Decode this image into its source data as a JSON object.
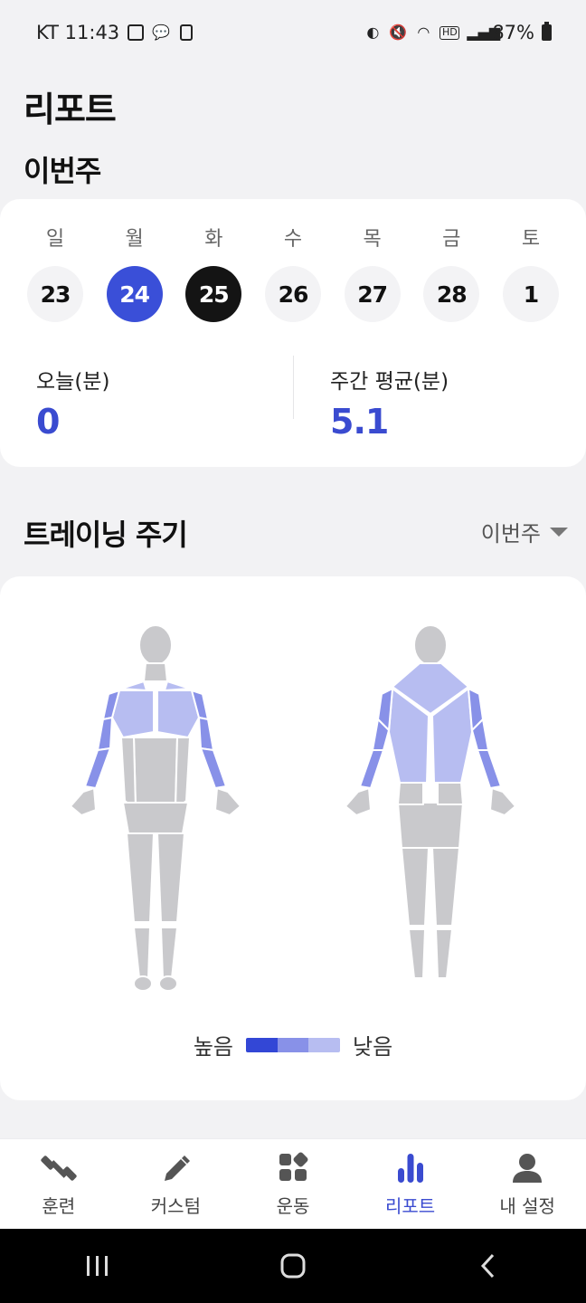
{
  "status_bar": {
    "carrier_time": "KT 11:43",
    "battery": "87%"
  },
  "page_title": "리포트",
  "week": {
    "title": "이번주",
    "days": [
      {
        "name": "일",
        "num": "23"
      },
      {
        "name": "월",
        "num": "24"
      },
      {
        "name": "화",
        "num": "25"
      },
      {
        "name": "수",
        "num": "26"
      },
      {
        "name": "목",
        "num": "27"
      },
      {
        "name": "금",
        "num": "28"
      },
      {
        "name": "토",
        "num": "1"
      }
    ],
    "selected_day": "24",
    "today_day": "25",
    "today_label": "오늘(분)",
    "today_value": "0",
    "avg_label": "주간 평균(분)",
    "avg_value": "5.1"
  },
  "training": {
    "title": "트레이닝 주기",
    "period": "이번주",
    "legend_high": "높음",
    "legend_low": "낮음",
    "colors": {
      "high": "#3347d6",
      "mid": "#8891e8",
      "low": "#b7bdf1",
      "inactive": "#c9c9cc"
    }
  },
  "nav": {
    "items": [
      {
        "label": "훈련",
        "icon": "dumbbell-icon"
      },
      {
        "label": "커스텀",
        "icon": "pencil-icon"
      },
      {
        "label": "운동",
        "icon": "grid-icon"
      },
      {
        "label": "리포트",
        "icon": "bar-chart-icon"
      },
      {
        "label": "내 설정",
        "icon": "person-icon"
      }
    ],
    "active": "리포트"
  },
  "accent_color": "#3a4bd0"
}
